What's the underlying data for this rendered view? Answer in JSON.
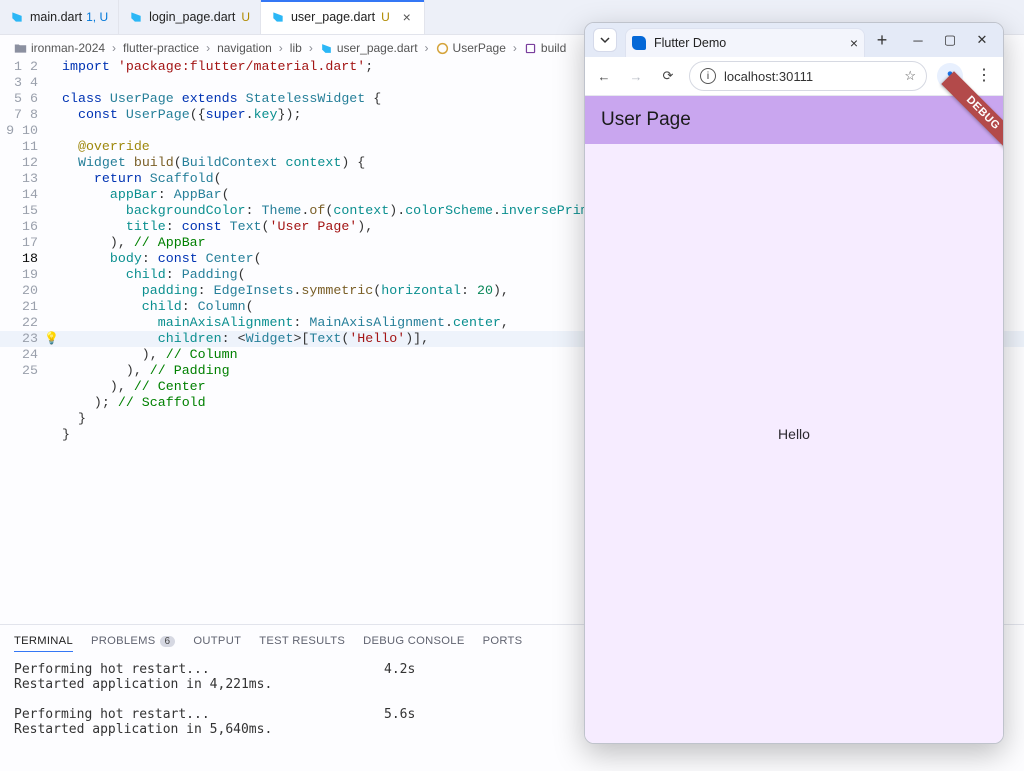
{
  "tabs": [
    {
      "label": "main.dart",
      "suffix": "1, U"
    },
    {
      "label": "login_page.dart",
      "suffix": "U"
    },
    {
      "label": "user_page.dart",
      "suffix": "U"
    }
  ],
  "breadcrumb": [
    "ironman-2024",
    "flutter-practice",
    "navigation",
    "lib"
  ],
  "breadcrumb_file": "user_page.dart",
  "breadcrumb_class": "UserPage",
  "breadcrumb_method": "build",
  "code_lines": 25,
  "bulb_line": 18,
  "highlight_line": 18,
  "code": {
    "l1_import": "import",
    "l1_pkg": "'package:flutter/material.dart'",
    "class_kw": "class",
    "class_name": "UserPage",
    "extends_kw": "extends",
    "super_class": "StatelessWidget",
    "const_kw": "const",
    "ctor_name": "UserPage",
    "super_key": "super",
    "key": "key",
    "override": "@override",
    "widget_ty": "Widget",
    "build": "build",
    "bc_ty": "BuildContext",
    "bc_p": "context",
    "return_kw": "return",
    "scaffold": "Scaffold",
    "appbar_name": "appBar",
    "appbar_cls": "AppBar",
    "bgc": "backgroundColor",
    "theme": "Theme",
    "of": "of",
    "cs": "colorScheme",
    "ip": "inversePrimary",
    "title": "title",
    "text_cls": "Text",
    "text_user": "'User Page'",
    "cmt_appbar": "// AppBar",
    "body": "body",
    "center_cls": "Center",
    "child": "child",
    "padding_cls": "Padding",
    "padding_name": "padding",
    "ei": "EdgeInsets",
    "sym": "symmetric",
    "horiz": "horizontal",
    "hval": "20",
    "column_cls": "Column",
    "maa": "mainAxisAlignment",
    "maa_cls": "MainAxisAlignment",
    "center_val": "center",
    "children": "children",
    "widget_g": "Widget",
    "hello": "'Hello'",
    "cmt_column": "// Column",
    "cmt_padding": "// Padding",
    "cmt_center": "// Center",
    "cmt_scaffold": "// Scaffold"
  },
  "panel": {
    "tabs": {
      "terminal": "TERMINAL",
      "problems": "PROBLEMS",
      "pcount": "6",
      "output": "OUTPUT",
      "test": "TEST RESULTS",
      "debug": "DEBUG CONSOLE",
      "ports": "PORTS"
    },
    "out": [
      {
        "a": "Performing hot restart...",
        "b": "4.2s"
      },
      {
        "a": "Restarted application in 4,221ms.",
        "b": ""
      },
      {
        "a": "",
        "b": ""
      },
      {
        "a": "Performing hot restart...",
        "b": "5.6s"
      },
      {
        "a": "Restarted application in 5,640ms.",
        "b": ""
      }
    ]
  },
  "browser": {
    "title": "Flutter Demo",
    "url": "localhost:30111",
    "appbar_title": "User Page",
    "body_text": "Hello",
    "debug": "DEBUG"
  }
}
